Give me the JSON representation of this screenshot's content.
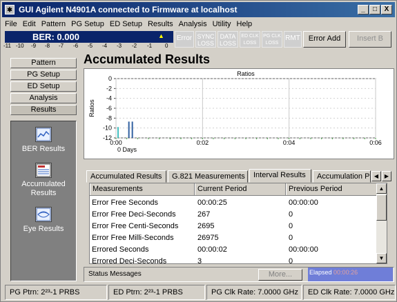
{
  "window": {
    "title": "GUI Agilent N4901A connected to Firmware at localhost",
    "controls": {
      "minimize": "_",
      "maximize": "□",
      "close": "X"
    }
  },
  "menu": [
    "File",
    "Edit",
    "Pattern",
    "PG Setup",
    "ED Setup",
    "Results",
    "Analysis",
    "Utility",
    "Help"
  ],
  "ber": {
    "label": "BER: 0.000",
    "scale_ticks": [
      "-11",
      "-10",
      "-9",
      "-8",
      "-7",
      "-6",
      "-5",
      "-4",
      "-3",
      "-2",
      "-1",
      "0"
    ]
  },
  "indicators": {
    "error": "Error",
    "sync_loss": [
      "SYNC",
      "LOSS"
    ],
    "data_loss": [
      "DATA",
      "LOSS"
    ],
    "ed_clk_loss": [
      "ED CLK",
      "LOSS"
    ],
    "pg_clk_loss": [
      "PG CLK",
      "LOSS"
    ],
    "rmt": "RMT"
  },
  "toolbar": {
    "error_add": "Error Add",
    "insert_b": "Insert B"
  },
  "nav": {
    "buttons": [
      "Pattern",
      "PG Setup",
      "ED Setup",
      "Analysis",
      "Results"
    ],
    "selected": "Results",
    "items": [
      {
        "label": "BER Results",
        "icon": "ber-results-icon"
      },
      {
        "label": "Accumulated Results",
        "icon": "accumulated-results-icon"
      },
      {
        "label": "Eye Results",
        "icon": "eye-results-icon"
      }
    ]
  },
  "page": {
    "heading": "Accumulated Results"
  },
  "chart_data": {
    "type": "bar",
    "title": "Ratios",
    "ylabel": "Ratios",
    "xlabel": "0 Days",
    "ylim": [
      -12,
      0
    ],
    "yticks": [
      "0",
      "-2",
      "-4",
      "-6",
      "-8",
      "-10",
      "-12"
    ],
    "xticks": [
      "0:00",
      "0:02",
      "0:04",
      "0:06"
    ],
    "xlim_minutes": [
      0,
      6
    ],
    "bars": [
      {
        "x_minutes": 0.0,
        "values": [
          -9.8
        ],
        "color": "#44c0c0"
      },
      {
        "x_minutes": 0.25,
        "values": [
          -8.7,
          -8.7
        ],
        "color": "#3060a0"
      }
    ],
    "grid": true
  },
  "tabs": {
    "items": [
      "Accumulated Results",
      "G.821 Measurements",
      "Interval Results",
      "Accumulation P"
    ],
    "selected": "Interval Results"
  },
  "table": {
    "headers": [
      "Measurements",
      "Current Period",
      "Previous Period"
    ],
    "rows": [
      [
        "Error Free Seconds",
        "00:00:25",
        "00:00:00"
      ],
      [
        "Error Free Deci-Seconds",
        "267",
        "0"
      ],
      [
        "Error Free Centi-Seconds",
        "2695",
        "0"
      ],
      [
        "Error Free Milli-Seconds",
        "26975",
        "0"
      ],
      [
        "Errored Seconds",
        "00:00:02",
        "00:00:00"
      ],
      [
        "Errored Deci-Seconds",
        "3",
        "0"
      ]
    ]
  },
  "status": {
    "label": "Status Messages",
    "more": "More...",
    "elapsed_label": "Elapsed",
    "elapsed_value": "00:00:26"
  },
  "statusbar": {
    "pg_ptrn": "PG Ptrn: 2²³-1 PRBS",
    "ed_ptrn": "ED Ptrn: 2²³-1 PRBS",
    "pg_clk": "PG Clk Rate: 7.0000 GHz",
    "ed_clk": "ED Clk Rate: 7.0000 GHz"
  },
  "colors": {
    "accent": "#0a246a",
    "elapsed_bg": "#6f7ed8",
    "indicator_off": "#cfcfcf"
  }
}
